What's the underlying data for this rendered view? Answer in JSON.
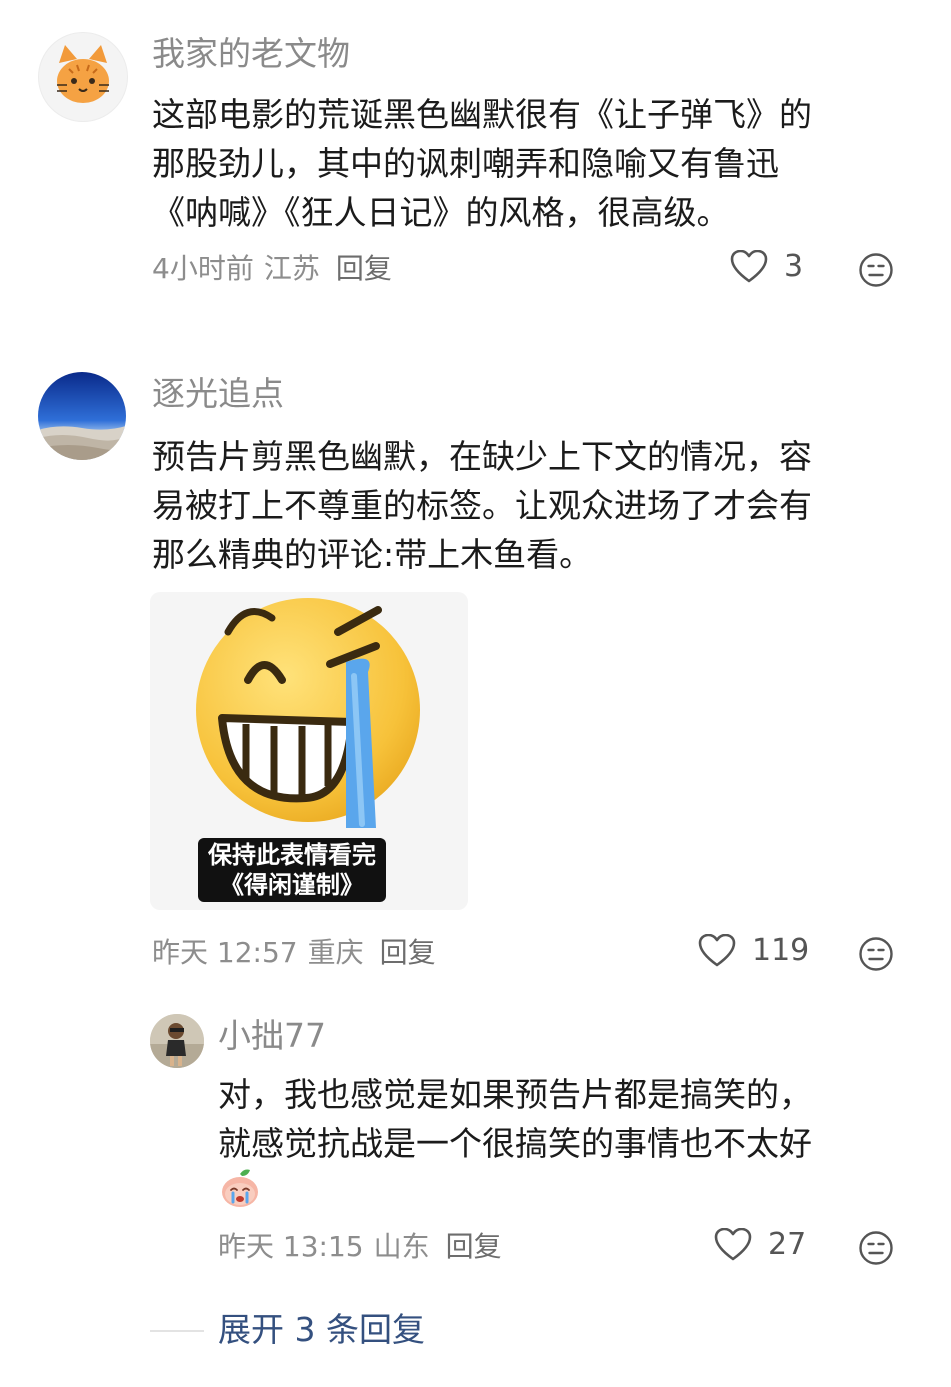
{
  "comments": [
    {
      "username": "我家的老文物",
      "content_lines": [
        "这部电影的荒诞黑色幽默很有《让子弹飞》的",
        "那股劲儿，其中的讽刺嘲弄和隐喻又有鲁迅",
        "《呐喊》《狂人日记》的风格，很高级。"
      ],
      "time": "4小时前",
      "location": "江苏",
      "reply_label": "回复",
      "likes": "3",
      "avatar_icon": "cat-face-icon"
    },
    {
      "username": "逐光追点",
      "content_lines": [
        "预告片剪黑色幽默，在缺少上下文的情况，容",
        "易被打上不尊重的标签。让观众进场了才会有",
        "那么精典的评论:带上木鱼看。"
      ],
      "sticker": {
        "caption_line1": "保持此表情看完",
        "caption_line2": "《得闲谨制》"
      },
      "time": "昨天 12:57",
      "location": "重庆",
      "reply_label": "回复",
      "likes": "119",
      "avatar_icon": "landscape-photo-avatar",
      "replies": [
        {
          "username": "小拙77",
          "content_lines": [
            "对，我也感觉是如果预告片都是搞笑的，",
            "就感觉抗战是一个很搞笑的事情也不太好"
          ],
          "time": "昨天 13:15",
          "location": "山东",
          "reply_label": "回复",
          "likes": "27",
          "emoji_icon": "crying-peach-emoji-icon"
        }
      ],
      "expand_label": "展开 3 条回复"
    }
  ],
  "colors": {
    "username": "#8a8a8a",
    "meta": "#8d8d8d",
    "expand": "#34507f"
  }
}
